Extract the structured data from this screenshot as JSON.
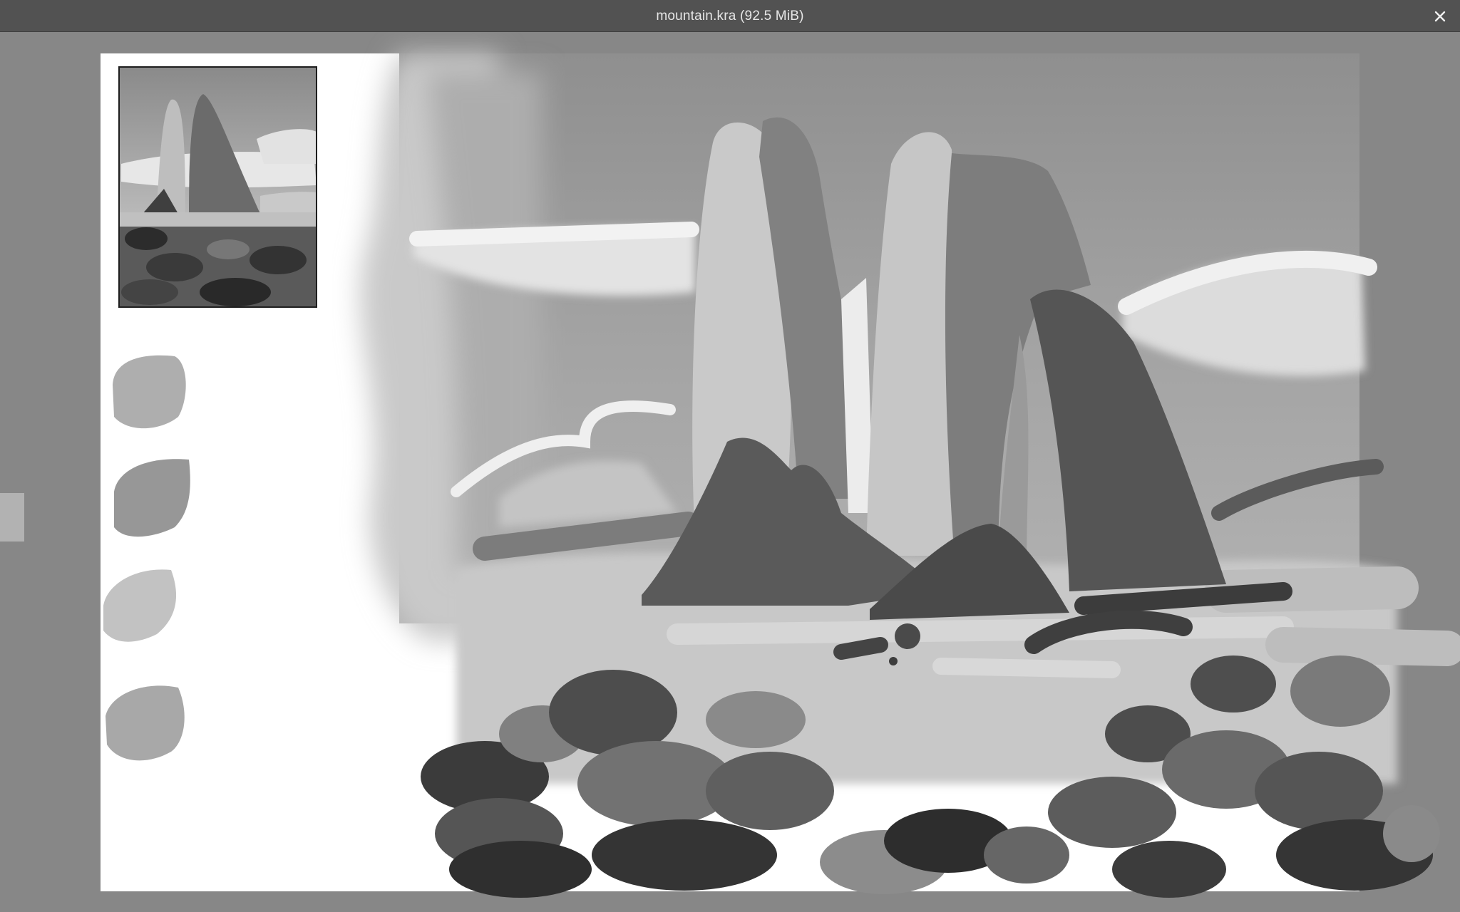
{
  "window": {
    "title": "mountain.kra (92.5 MiB)",
    "close_icon": "close-icon"
  },
  "canvas": {
    "background_color": "#ffffff",
    "workspace_color": "#878787",
    "reference_thumbnail": "reference-image",
    "swatches": [
      {
        "name": "swatch-light-gray",
        "color": "#aeaeae"
      },
      {
        "name": "swatch-mid-gray",
        "color": "#979797"
      },
      {
        "name": "swatch-pale-gray",
        "color": "#c2c2c2"
      },
      {
        "name": "swatch-gray",
        "color": "#a8a8a8"
      }
    ]
  },
  "colors": {
    "titlebar": "#525252",
    "sky": "#9d9d9d",
    "cloud": "#ebebeb",
    "rock_dark": "#555555",
    "rock_darkest": "#2e2e2e"
  }
}
